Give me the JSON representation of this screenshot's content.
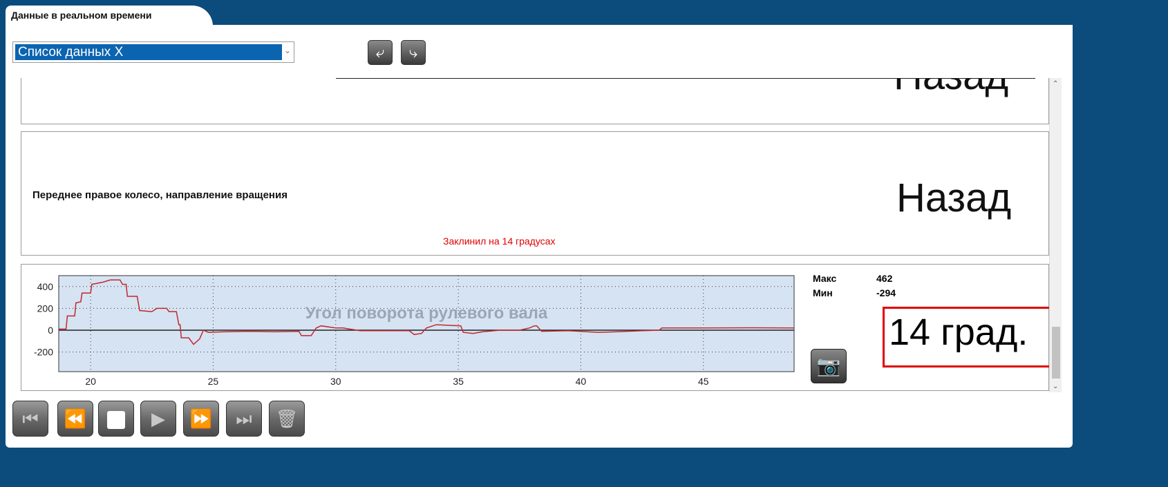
{
  "tab": {
    "title": "Данные в реальном времени"
  },
  "toolbar": {
    "list_select": "Список данных X",
    "back_icon": "arrow-back-icon",
    "forward_icon": "arrow-forward-icon"
  },
  "rows": [
    {
      "value": "Назад"
    },
    {
      "label": "Переднее правое колесо, направление вращения",
      "value": "Назад",
      "annotation": "Заклинил на 14 градусах"
    },
    {
      "stats": {
        "max_label": "Макс",
        "max_value": "462",
        "min_label": "Мин",
        "min_value": "-294"
      },
      "current_value": "14 град."
    }
  ],
  "colors": {
    "frame": "#0b4c7d",
    "line": "#c0282d",
    "plot_bg": "#d6e3f2",
    "highlight": "#e00000"
  },
  "chart_data": {
    "type": "line",
    "title": "Угол поворота рулевого вала",
    "xlim": [
      18.7,
      48.7
    ],
    "ylim": [
      -380,
      500
    ],
    "xticks": [
      20,
      25,
      30,
      35,
      40,
      45
    ],
    "yticks": [
      400,
      200,
      0,
      -200
    ],
    "grid": true,
    "x": [
      18.7,
      19.0,
      19.05,
      19.35,
      19.4,
      19.6,
      19.65,
      20.0,
      20.05,
      20.5,
      20.8,
      21.2,
      21.3,
      21.45,
      21.5,
      21.9,
      22.0,
      22.5,
      22.7,
      23.1,
      23.2,
      23.5,
      23.6,
      23.65,
      23.7,
      24.0,
      24.2,
      24.45,
      24.6,
      24.8,
      25.5,
      26.5,
      27.5,
      28.5,
      28.6,
      29.0,
      29.2,
      29.4,
      30.0,
      30.3,
      31.0,
      32.0,
      33.0,
      33.2,
      33.5,
      33.7,
      34.1,
      35.1,
      35.2,
      35.6,
      36.0,
      36.7,
      37.5,
      37.9,
      38.1,
      38.2,
      38.4,
      39.5,
      40.7,
      41.5,
      42.5,
      43.2,
      43.3,
      45,
      47,
      48.7
    ],
    "y": [
      10,
      10,
      130,
      130,
      250,
      260,
      340,
      340,
      420,
      440,
      460,
      460,
      420,
      420,
      310,
      310,
      180,
      170,
      200,
      200,
      170,
      170,
      50,
      50,
      -70,
      -70,
      -130,
      -80,
      0,
      -20,
      -15,
      -10,
      -15,
      -10,
      -50,
      -50,
      20,
      40,
      20,
      20,
      -5,
      -5,
      -5,
      -40,
      -30,
      20,
      50,
      40,
      -20,
      -30,
      -15,
      0,
      0,
      20,
      40,
      40,
      -10,
      -5,
      -20,
      -15,
      -5,
      0,
      20,
      20,
      22,
      20
    ]
  }
}
